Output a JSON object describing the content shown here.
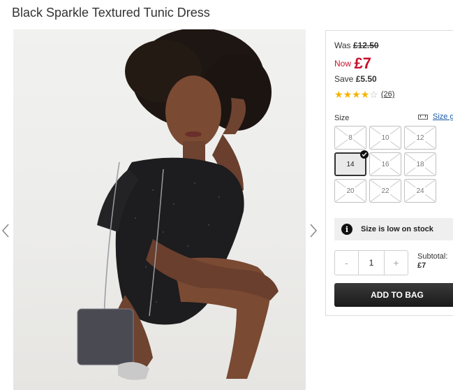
{
  "product": {
    "title": "Black Sparkle Textured Tunic Dress"
  },
  "gallery": {
    "prev_icon": "chevron-left-icon",
    "next_icon": "chevron-right-icon"
  },
  "pricing": {
    "was_label": "Was",
    "was_price": "£12.50",
    "now_label": "Now",
    "now_price": "£7",
    "save_label": "Save",
    "save_amount": "£5.50",
    "accent_color": "#c8102e"
  },
  "rating": {
    "stars": 4,
    "max_stars": 5,
    "count": "(26)"
  },
  "size": {
    "label": "Size",
    "guide_label": "Size g",
    "selected": "14",
    "options": [
      {
        "label": "8",
        "available": false
      },
      {
        "label": "10",
        "available": false
      },
      {
        "label": "12",
        "available": false
      },
      {
        "label": "14",
        "available": true
      },
      {
        "label": "16",
        "available": false
      },
      {
        "label": "18",
        "available": false
      },
      {
        "label": "20",
        "available": false
      },
      {
        "label": "22",
        "available": false
      },
      {
        "label": "24",
        "available": false
      }
    ]
  },
  "stock": {
    "message": "Size is low on stock",
    "icon": "info-icon"
  },
  "quantity": {
    "minus": "-",
    "value": "1",
    "plus": "+"
  },
  "subtotal": {
    "label": "Subtotal:",
    "value": "£7"
  },
  "cart": {
    "add_label": "ADD TO BAG"
  }
}
